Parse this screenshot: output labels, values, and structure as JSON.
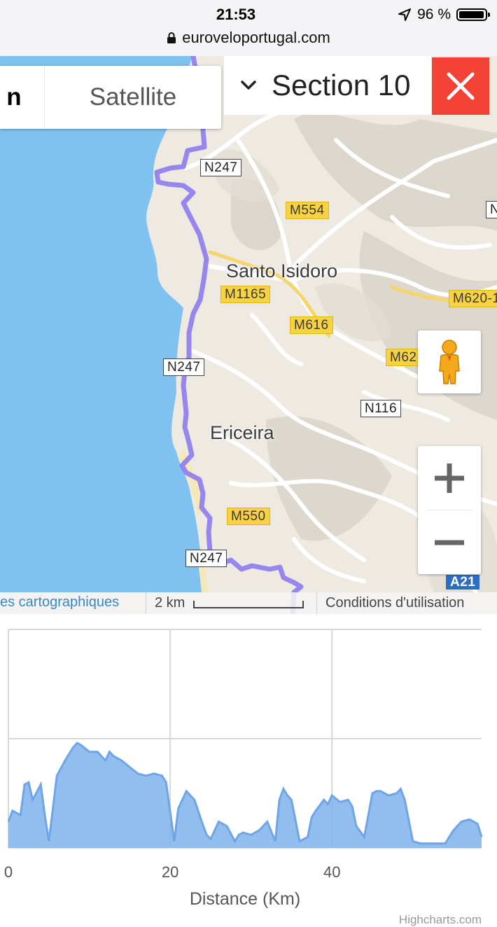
{
  "status_bar": {
    "time": "21:53",
    "battery_percent": "96 %",
    "battery_level": 0.96,
    "url": "euroveloportugal.com",
    "icons": [
      "location-arrow-icon",
      "battery-icon",
      "lock-icon"
    ]
  },
  "map": {
    "map_type_tabs": {
      "map_label_fragment": "n",
      "satellite_label": "Satellite"
    },
    "section_selector": {
      "label": "Section 10"
    },
    "road_shields": {
      "n247_a": "N247",
      "n247_b": "N247",
      "n247_c": "N247",
      "m554": "M554",
      "m1165": "M1165",
      "m616": "M616",
      "m620": "M620-1",
      "m62": "M62",
      "n116": "N116",
      "m550": "M550",
      "a21": "A21",
      "edge_n": "N"
    },
    "places": {
      "santo_isidoro": "Santo Isidoro",
      "ericeira": "Ericeira"
    },
    "footer": {
      "data_link": "es cartographiques",
      "scale_label": "2 km",
      "terms": "Conditions d'utilisation"
    },
    "colors": {
      "water": "#7fc2f0",
      "land": "#eeeae2",
      "route": "#8d7bef",
      "close_button": "#f44336",
      "shield_yellow": "#f9d241",
      "shield_blue": "#2c6fc2"
    }
  },
  "chart_data": {
    "type": "area",
    "title": "",
    "xlabel": "Distance (Km)",
    "ylabel": "",
    "x_ticks": [
      "0",
      "20",
      "40"
    ],
    "xlim": [
      0,
      58.5
    ],
    "y_ticks_labels_shown": false,
    "ylim": [
      0,
      100
    ],
    "grid": true,
    "series": [
      {
        "name": "",
        "color": "#7fb2ec",
        "x": [
          0,
          0.5,
          1.5,
          2.0,
          2.5,
          3.0,
          4.0,
          4.5,
          5.0,
          6.0,
          7.0,
          8.0,
          8.5,
          9.0,
          10.0,
          11.0,
          12.0,
          12.5,
          13.0,
          14.0,
          15.0,
          16.0,
          17.0,
          18.0,
          19.0,
          19.5,
          20.5,
          21.0,
          22.0,
          23.0,
          24.0,
          24.5,
          25.0,
          26.0,
          27.0,
          28.0,
          28.5,
          29.0,
          30.0,
          31.0,
          32.0,
          33.0,
          33.5,
          34.0,
          34.5,
          35.0,
          36.0,
          37.0,
          37.5,
          38.0,
          39.0,
          39.5,
          40.0,
          41.0,
          42.0,
          42.5,
          43.0,
          44.0,
          45.0,
          45.5,
          46.0,
          47.0,
          48.0,
          48.5,
          49.0,
          50.0,
          51.0,
          52.0,
          53.0,
          54.0,
          55.0,
          56.0,
          57.0,
          58.0,
          58.5
        ],
        "values": [
          12,
          17,
          15,
          29,
          30,
          22,
          29,
          15,
          3,
          33,
          40,
          46,
          48,
          47,
          44,
          44,
          40,
          44,
          42,
          40,
          37,
          34,
          33,
          34,
          33,
          30,
          3,
          18,
          26,
          22,
          11,
          6,
          4,
          12,
          10,
          3,
          6,
          7,
          6,
          8,
          12,
          3,
          22,
          27,
          24,
          22,
          3,
          5,
          14,
          17,
          22,
          20,
          24,
          21,
          22,
          19,
          10,
          5,
          25,
          26,
          26,
          24,
          25,
          27,
          22,
          3,
          2,
          2,
          2,
          2,
          8,
          12,
          13,
          11,
          5
        ]
      }
    ]
  }
}
